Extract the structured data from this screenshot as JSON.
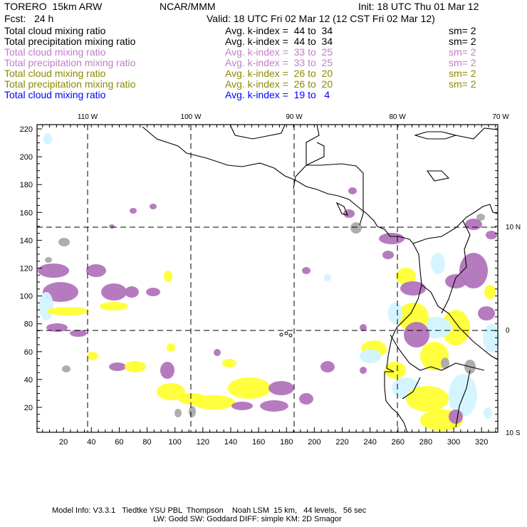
{
  "header": {
    "model": "TORERO  15km ARW",
    "agency": "NCAR/MMM",
    "init": "Init: 18 UTC Thu 01 Mar 12",
    "fcst": "Fcst:   24 h",
    "valid": "Valid: 18 UTC Fri 02 Mar 12 (12 CST Fri 02 Mar 12)"
  },
  "legend": [
    {
      "field": "Total cloud mixing ratio",
      "range": "Avg. k-index =  44 to  34",
      "sm": "sm= 2",
      "color": "#000000"
    },
    {
      "field": "Total precipitation mixing ratio",
      "range": "Avg. k-index =  44 to  34",
      "sm": "sm= 2",
      "color": "#000000"
    },
    {
      "field": "Total cloud mixing ratio",
      "range": "Avg. k-index =  33 to  25",
      "sm": "sm= 2",
      "color": "#c07ec8"
    },
    {
      "field": "Total precipitation mixing ratio",
      "range": "Avg. k-index =  33 to  25",
      "sm": "sm= 2",
      "color": "#c07ec8"
    },
    {
      "field": "Total cloud mixing ratio",
      "range": "Avg. k-index =  26 to  20",
      "sm": "sm= 2",
      "color": "#8a8a00"
    },
    {
      "field": "Total precipitation mixing ratio",
      "range": "Avg. k-index =  26 to  20",
      "sm": "sm= 2",
      "color": "#8a8a00"
    },
    {
      "field": "Total cloud mixing ratio",
      "range": "Avg. k-index =  19 to   4",
      "sm": "",
      "color": "#0000ff"
    }
  ],
  "map": {
    "x_ticks": [
      "20",
      "40",
      "60",
      "80",
      "100",
      "120",
      "140",
      "160",
      "180",
      "200",
      "220",
      "240",
      "260",
      "280",
      "300",
      "320"
    ],
    "y_ticks": [
      "20",
      "40",
      "60",
      "80",
      "100",
      "120",
      "140",
      "160",
      "180",
      "200",
      "220"
    ],
    "lon_labels": [
      "110 W",
      "100 W",
      "90 W",
      "80 W",
      "70 W"
    ],
    "lat_labels": [
      "10 N",
      "0",
      "10 S"
    ],
    "shading_colors": {
      "gray": "#aaaaaa",
      "purple": "#b274bc",
      "yellow": "#ffff33",
      "light_blue": "#d2f4ff"
    }
  },
  "footer": {
    "line1": "Model Info: V3.3.1   Tiedtke YSU PBL  Thompson    Noah LSM  15 km,   44 levels,   56 sec",
    "line2": "LW: Godd SW: Goddard DIFF: simple KM: 2D Smagor"
  }
}
